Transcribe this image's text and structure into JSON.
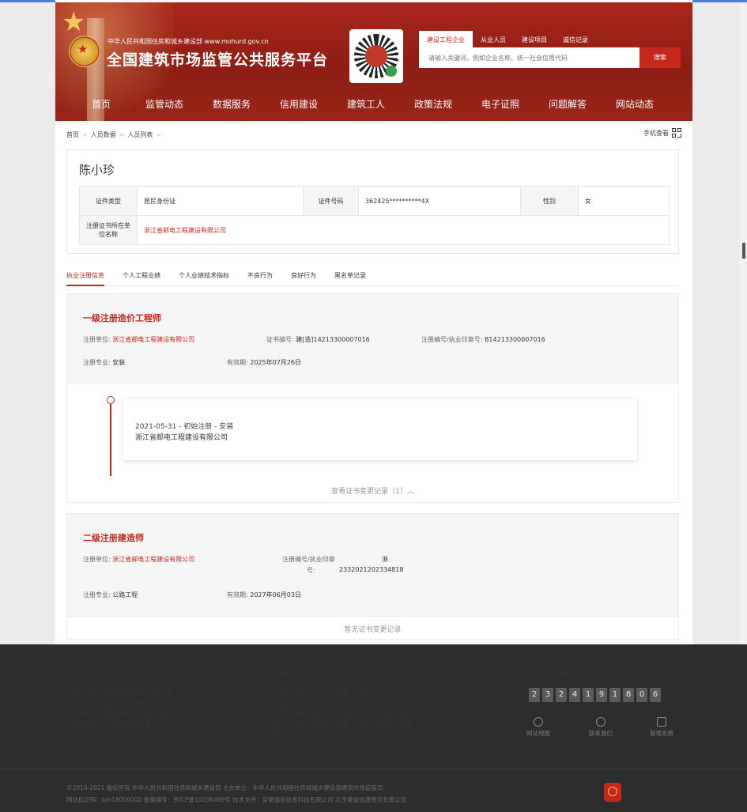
{
  "header": {
    "org_line": "中华人民共和国住房和城乡建设部  www.mohurd.gov.cn",
    "site_title": "全国建筑市场监管公共服务平台",
    "search_tabs": [
      "建设工程企业",
      "从业人员",
      "建设项目",
      "诚信记录"
    ],
    "search_placeholder": "请输入关键词，例如企业名称、统一社会信用代码",
    "search_button": "搜索",
    "nav": [
      "首页",
      "监管动态",
      "数据服务",
      "信用建设",
      "建筑工人",
      "政策法规",
      "电子证照",
      "问题解答",
      "网站动态"
    ]
  },
  "breadcrumb": [
    "首页",
    "人员数据",
    "人员列表"
  ],
  "mobile_view": "手机查看",
  "person": {
    "name": "陈小珍",
    "id_type_label": "证件类型",
    "id_type": "居民身份证",
    "id_no_label": "证件号码",
    "id_no": "362425**********4X",
    "gender_label": "性别",
    "gender": "女",
    "unit_label": "注册证书所在单位名称",
    "unit": "浙江省邮电工程建设有限公司"
  },
  "tabs": [
    "执业注册信息",
    "个人工程业绩",
    "个人业绩技术指标",
    "不良行为",
    "良好行为",
    "黑名单记录"
  ],
  "cert1": {
    "title": "一级注册造价工程师",
    "unit_label": "注册单位:",
    "unit": "浙江省邮电工程建设有限公司",
    "cert_no_label": "证书编号:",
    "cert_no": "建[造]14213300007016",
    "reg_no_label": "注册编号/执业印章号:",
    "reg_no": "B14213300007016",
    "major_label": "注册专业:",
    "major": "安装",
    "valid_label": "有效期:",
    "valid": "2025年07月26日",
    "timeline_line1": "2021-05-31 - 初始注册 - 安装",
    "timeline_line2": "浙江省邮电工程建设有限公司",
    "more": "查看证书变更记录（1）︿"
  },
  "cert2": {
    "title": "二级注册建造师",
    "unit_label": "注册单位:",
    "unit": "浙江省邮电工程建设有限公司",
    "reg_no_label_a": "注册编号/执业印章",
    "reg_no_label_b": "号:",
    "reg_no_a": "浙",
    "reg_no_b": "2332021202334818",
    "major_label": "注册专业:",
    "major": "公路工程",
    "valid_label": "有效期:",
    "valid": "2027年06月03日",
    "more": "暂无证书变更记录"
  },
  "footer": {
    "nav_title": "相关网站导航",
    "nav_links": [
      "中华人民共和国住房和城乡建设部",
      "国家工程建设标准化信息网",
      "住房和城乡建设部执业资格注册中心",
      "全国建筑工人管理服务信息平台"
    ],
    "prov_title": "各省级一体化平台",
    "prov_lines": [
      "北京 / 天津 / 河北 / 山西 / 内蒙古 / 辽宁 / 吉林",
      "黑龙江 / 上海 / 江苏 / 浙江 / 安徽 / 福建 / 江西",
      "山东 / 河南 / 湖北 / 湖南 / 广东 / 广西 / 海南",
      "重庆 / 四川 / 贵州 / 云南 / 西藏 / 陕西 / 甘肃",
      "青海 / 宁夏 / 新疆"
    ],
    "visits_title": "网站访问数量",
    "visits_digits": [
      "2",
      "3",
      "2",
      "4",
      "1",
      "9",
      "1",
      "8",
      "0",
      "6"
    ],
    "icons": [
      "网站地图",
      "联系我们",
      "管理系统"
    ],
    "copyright": "©2016-2021 版权所有 中华人民共和国住房和城乡建设部   主办单位：中华人民共和国住房和城乡建设部建筑市场监管司",
    "icp": "网站标识码：bm18000002   备案编号：京ICP备10036469号   技术支持：安徽德拓信息科技有限公司 北京建设信源资讯有限公司"
  },
  "colors": {
    "brand_red": "#c5271b",
    "header_red": "#9a2418",
    "footer_bg": "#2d2d2d"
  }
}
